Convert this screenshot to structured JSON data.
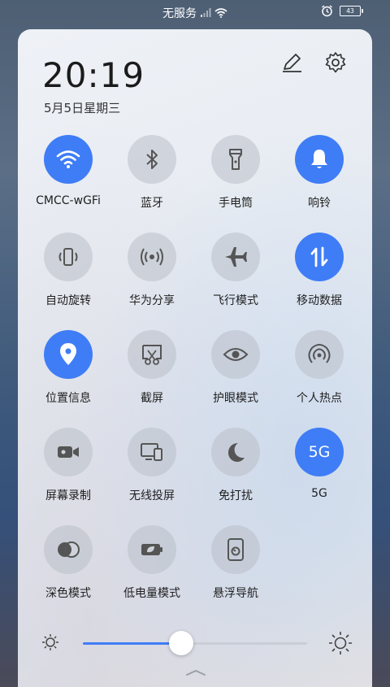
{
  "status_bar": {
    "carrier": "无服务",
    "battery": "43"
  },
  "clock": {
    "time": "20:19",
    "date": "5月5日星期三"
  },
  "tiles": [
    {
      "label": "CMCC-wGFi",
      "icon": "wifi-icon",
      "active": true
    },
    {
      "label": "蓝牙",
      "icon": "bluetooth-icon",
      "active": false
    },
    {
      "label": "手电筒",
      "icon": "flashlight-icon",
      "active": false
    },
    {
      "label": "响铃",
      "icon": "bell-icon",
      "active": true
    },
    {
      "label": "自动旋转",
      "icon": "auto-rotate-icon",
      "active": false
    },
    {
      "label": "华为分享",
      "icon": "huawei-share-icon",
      "active": false
    },
    {
      "label": "飞行模式",
      "icon": "airplane-icon",
      "active": false
    },
    {
      "label": "移动数据",
      "icon": "mobile-data-icon",
      "active": true
    },
    {
      "label": "位置信息",
      "icon": "location-icon",
      "active": true
    },
    {
      "label": "截屏",
      "icon": "screenshot-icon",
      "active": false
    },
    {
      "label": "护眼模式",
      "icon": "eye-icon",
      "active": false
    },
    {
      "label": "个人热点",
      "icon": "hotspot-icon",
      "active": false
    },
    {
      "label": "屏幕录制",
      "icon": "screen-record-icon",
      "active": false
    },
    {
      "label": "无线投屏",
      "icon": "wireless-projection-icon",
      "active": false
    },
    {
      "label": "免打扰",
      "icon": "moon-icon",
      "active": false
    },
    {
      "label": "5G",
      "icon": "5g-icon",
      "icon_text": "5G",
      "active": true
    },
    {
      "label": "深色模式",
      "icon": "dark-mode-icon",
      "active": false
    },
    {
      "label": "低电量模式",
      "icon": "battery-saver-icon",
      "active": false
    },
    {
      "label": "悬浮导航",
      "icon": "floating-nav-icon",
      "active": false
    }
  ],
  "brightness": {
    "level": 0.44
  },
  "colors": {
    "accent": "#3f7df6",
    "tile_inactive": "#b9c0c8"
  }
}
